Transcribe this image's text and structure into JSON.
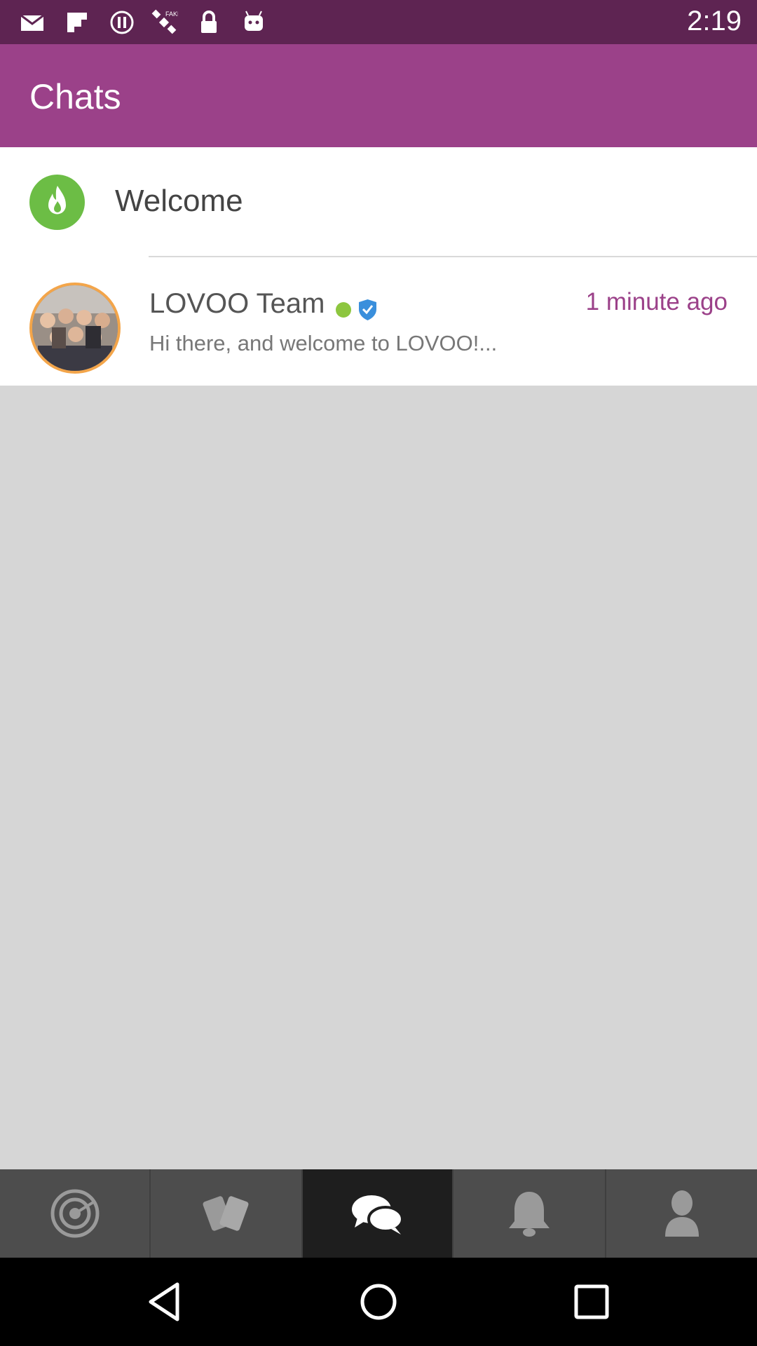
{
  "status_bar": {
    "time": "2:19",
    "icons": [
      "mail-icon",
      "flipboard-icon",
      "alert-icon",
      "satellite-icon",
      "lock-icon",
      "android-icon"
    ]
  },
  "app_bar": {
    "title": "Chats"
  },
  "welcome": {
    "label": "Welcome",
    "icon": "flame-icon"
  },
  "chats": [
    {
      "name": "LOVOO Team",
      "online": true,
      "verified": true,
      "time": "1 minute ago",
      "preview": "Hi there, and welcome to LOVOO!..."
    }
  ],
  "bottom_nav": [
    {
      "name": "radar",
      "icon": "radar-icon",
      "active": false
    },
    {
      "name": "match",
      "icon": "cards-icon",
      "active": false
    },
    {
      "name": "chats",
      "icon": "chat-bubbles-icon",
      "active": true
    },
    {
      "name": "notifications",
      "icon": "bell-icon",
      "active": false
    },
    {
      "name": "profile",
      "icon": "person-icon",
      "active": false
    }
  ],
  "system_nav": [
    "back-icon",
    "home-icon",
    "recents-icon"
  ],
  "colors": {
    "status_bar": "#5e2452",
    "app_bar": "#9b4189",
    "accent_time": "#9b4189",
    "welcome_icon": "#6cbd45",
    "online": "#8dc63f",
    "verified": "#3a8fdc",
    "avatar_ring": "#f3a54a",
    "nav_bg": "#4d4d4d",
    "nav_active": "#1e1e1e"
  }
}
